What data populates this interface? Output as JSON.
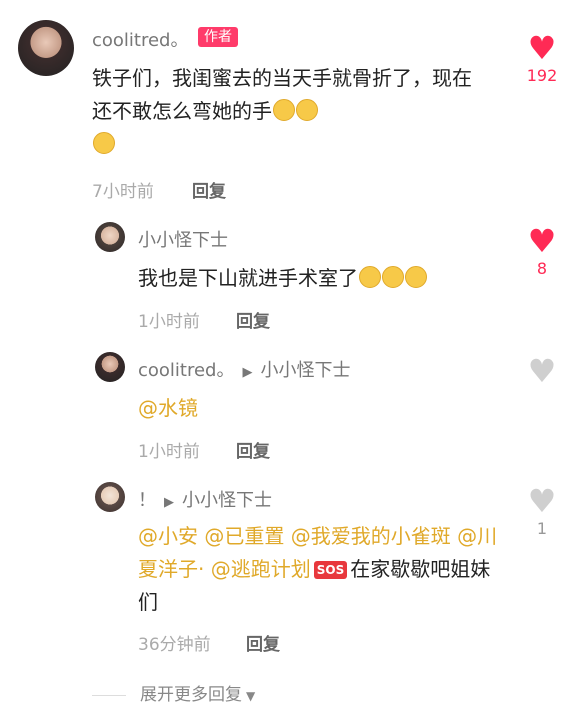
{
  "comments": [
    {
      "user": "coolitred。",
      "badge": "作者",
      "text": "铁子们，我闺蜜去的当天手就骨折了，现在还不敢怎么弯她的手",
      "time": "7小时前",
      "reply": "回复",
      "likes": "192",
      "liked": true
    },
    {
      "user": "小小怪下士",
      "text": "我也是下山就进手术室了",
      "time": "1小时前",
      "reply": "回复",
      "likes": "8",
      "liked": true
    },
    {
      "user": "coolitred。",
      "reply_to": "小小怪下士",
      "text": "@水镜",
      "time": "1小时前",
      "reply": "回复",
      "likes": "",
      "liked": false
    },
    {
      "user": "！",
      "reply_to": "小小怪下士",
      "mentions": [
        "@小安",
        "@已重置",
        "@我爱我的小雀斑",
        "@川夏洋子·",
        "@逃跑计划"
      ],
      "sos": "SOS",
      "text_after": "在家歇歇吧姐妹们",
      "time": "36分钟前",
      "reply": "回复",
      "likes": "1",
      "liked": false
    }
  ],
  "expand_more": "展开更多回复",
  "icons": {
    "like": "heart-icon",
    "reply_arrow": "play-arrow-icon",
    "expand": "chevron-down-icon"
  },
  "colors": {
    "accent": "#ff2a55",
    "mention": "#e0a92a",
    "badge": "#ff3b6a"
  }
}
